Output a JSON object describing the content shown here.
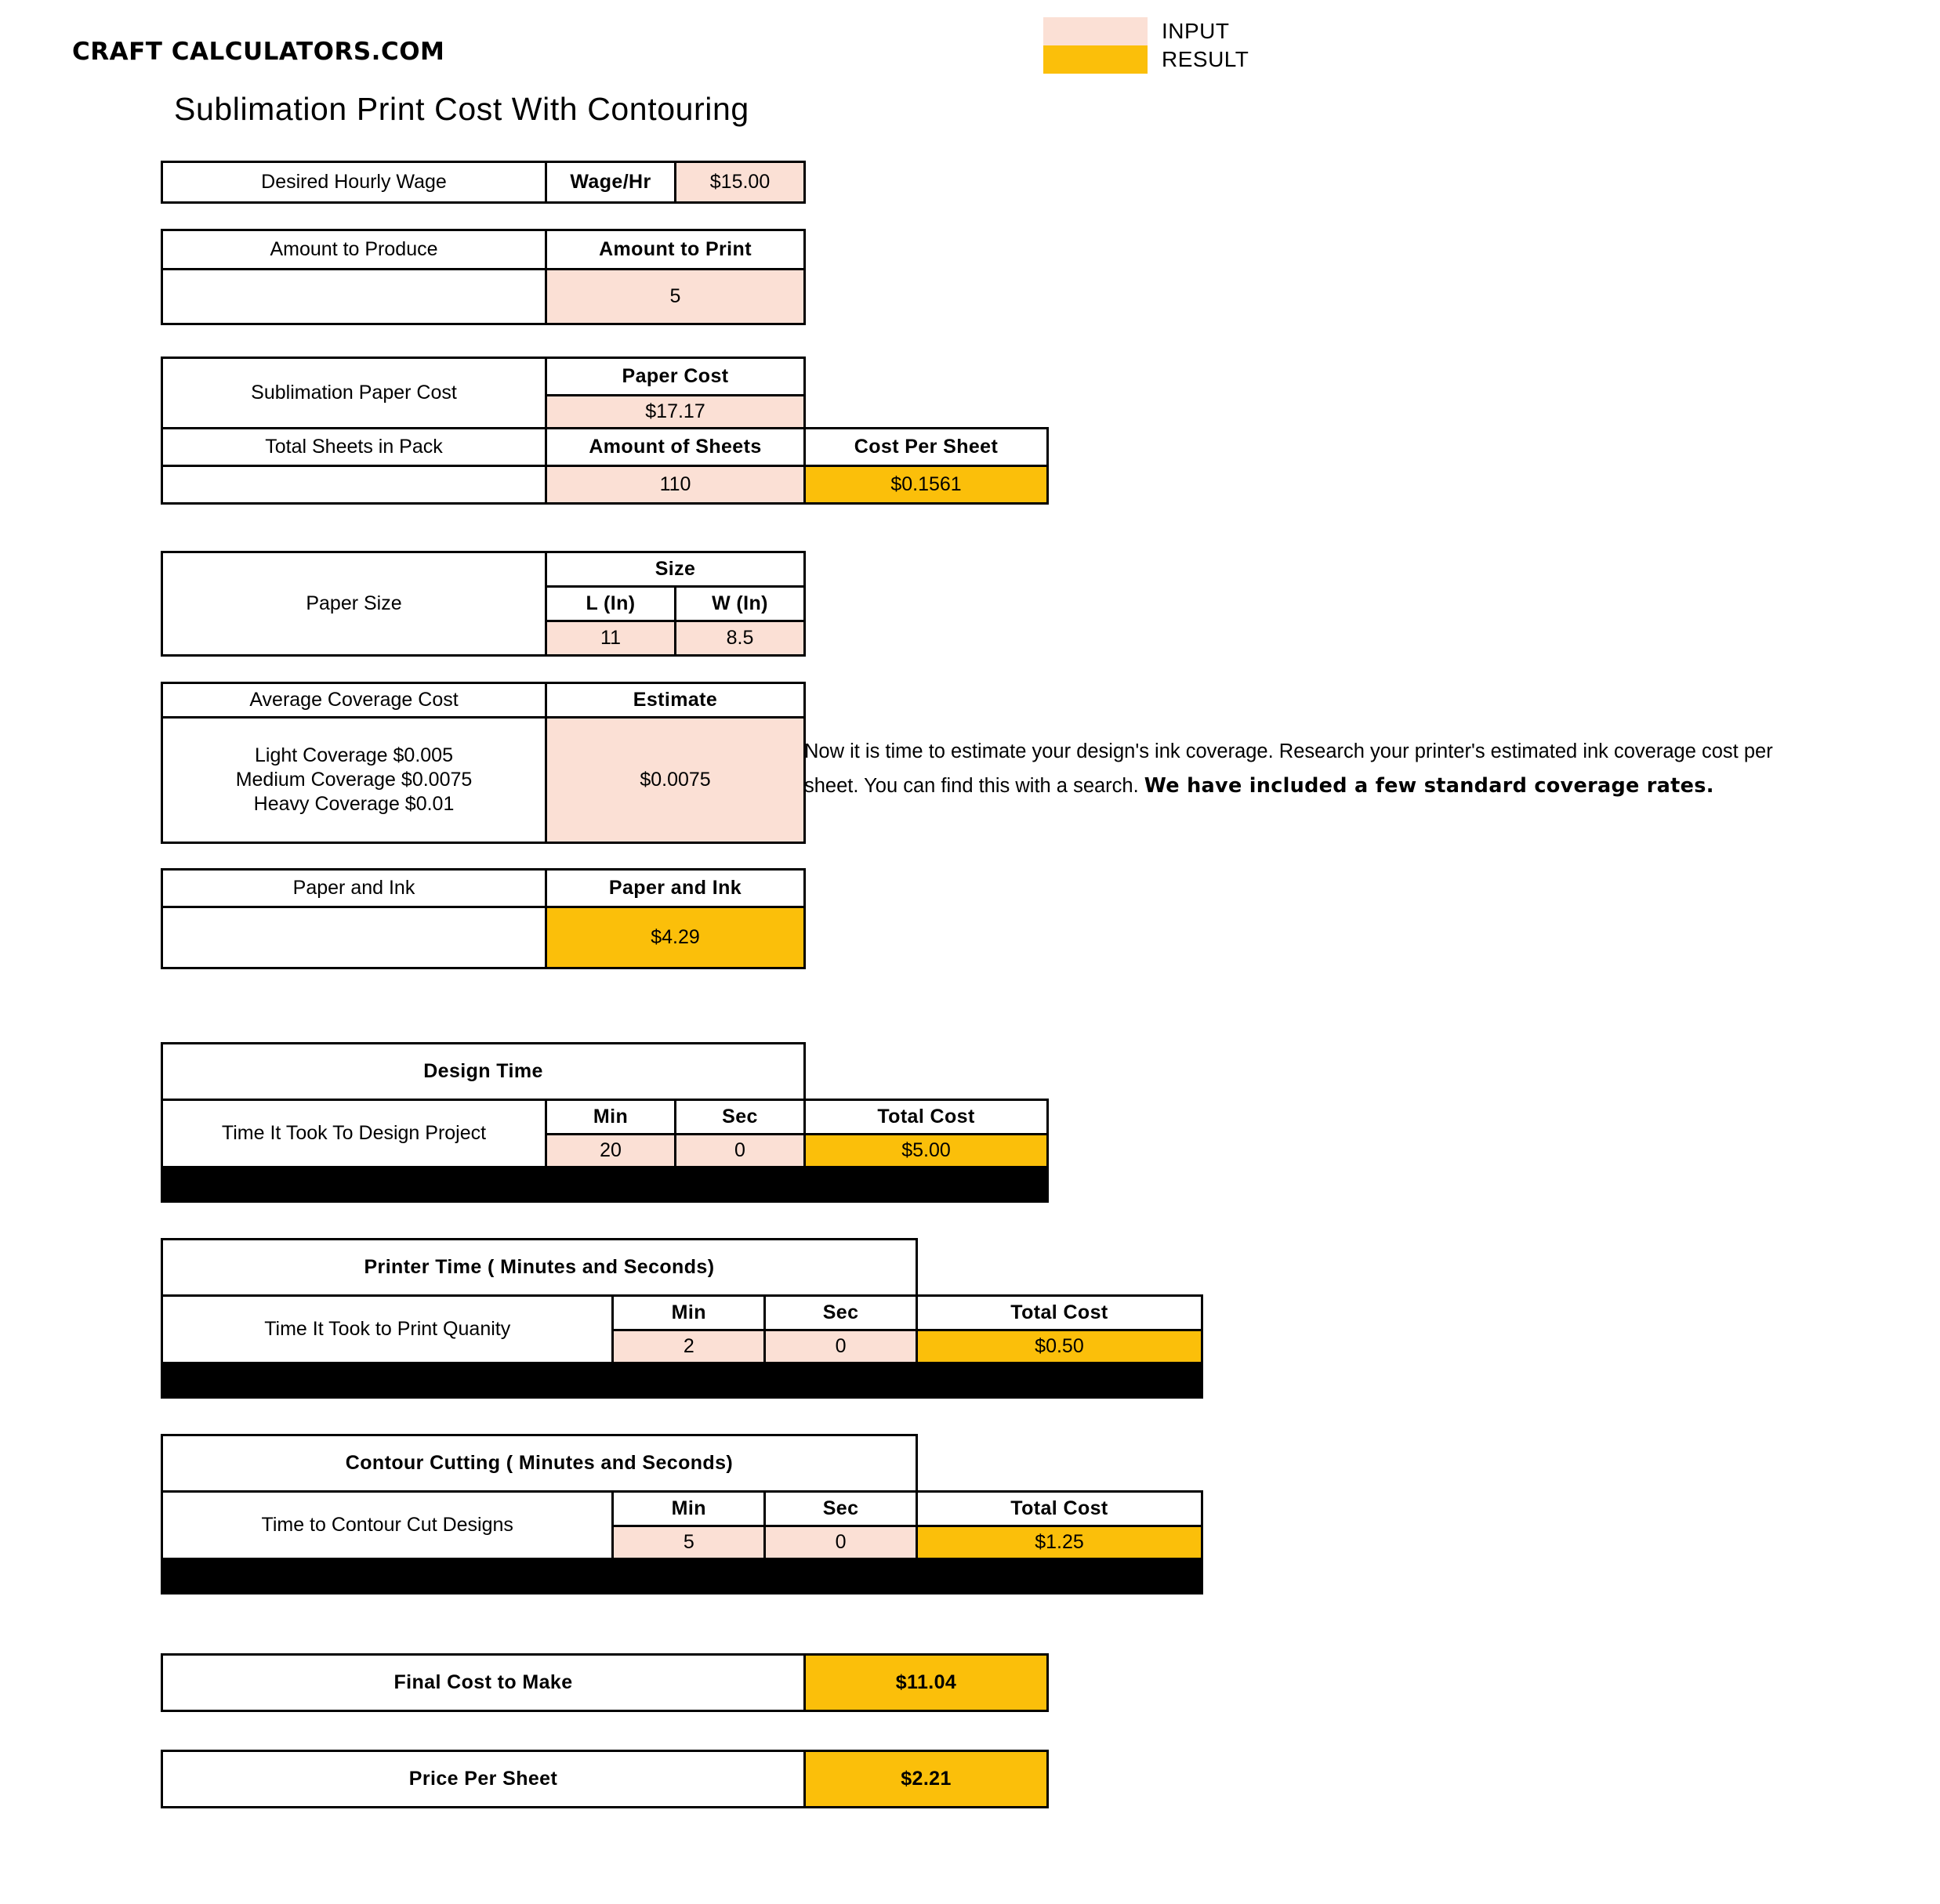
{
  "brand": "CRAFT CALCULATORS.COM",
  "page_title": "Sublimation Print Cost With Contouring",
  "colors": {
    "input": "#FBE0D5",
    "result": "#FBBF0A",
    "border": "#000000",
    "black_bar": "#000000"
  },
  "legend": {
    "items": [
      {
        "label": "INPUT",
        "color": "#FBE0D5"
      },
      {
        "label": "RESULT",
        "color": "#FBBF0A"
      }
    ]
  },
  "wage": {
    "row_label": "Desired Hourly Wage",
    "field_label": "Wage/Hr",
    "value": "$15.00"
  },
  "amount": {
    "row_label": "Amount to Produce",
    "field_label": "Amount to Print",
    "value": "5"
  },
  "paper": {
    "cost_row_label": "Sublimation Paper Cost",
    "cost_header": "Paper Cost",
    "cost_value": "$17.17",
    "sheets_row_label": "Total Sheets in Pack",
    "sheets_header": "Amount of Sheets",
    "sheets_value": "110",
    "cost_per_sheet_header": "Cost Per Sheet",
    "cost_per_sheet_value": "$0.1561"
  },
  "size": {
    "row_label": "Paper Size",
    "group_header": "Size",
    "length_header": "L (In)",
    "width_header": "W (In)",
    "length_value": "11",
    "width_value": "8.5"
  },
  "coverage": {
    "row_label": "Average Coverage Cost",
    "estimate_header": "Estimate",
    "options": [
      "Light Coverage $0.005",
      "Medium Coverage $0.0075",
      "Heavy Coverage $0.01"
    ],
    "estimate_value": "$0.0075",
    "note_plain_1": "Now it is time to estimate your design's ink coverage. Research your printer's estimated ink coverage cost per sheet. You can find this with a search. ",
    "note_bold": "We have included a few standard coverage rates."
  },
  "paper_and_ink": {
    "row_label": "Paper and Ink",
    "header": "Paper and Ink",
    "value": "$4.29"
  },
  "time_sections": [
    {
      "title": "Design Time",
      "row_label": "Time It Took To Design Project",
      "min_header": "Min",
      "sec_header": "Sec",
      "total_header": "Total Cost",
      "min_value": "20",
      "sec_value": "0",
      "total_value": "$5.00"
    },
    {
      "title": "Printer Time ( Minutes and Seconds)",
      "row_label": "Time It Took to Print Quanity",
      "min_header": "Min",
      "sec_header": "Sec",
      "total_header": "Total Cost",
      "min_value": "2",
      "sec_value": "0",
      "total_value": "$0.50"
    },
    {
      "title": "Contour Cutting ( Minutes and Seconds)",
      "row_label": "Time to Contour Cut Designs",
      "min_header": "Min",
      "sec_header": "Sec",
      "total_header": "Total Cost",
      "min_value": "5",
      "sec_value": "0",
      "total_value": "$1.25"
    }
  ],
  "totals": [
    {
      "label": "Final Cost to Make",
      "value": "$11.04"
    },
    {
      "label": "Price Per Sheet",
      "value": "$2.21"
    }
  ]
}
